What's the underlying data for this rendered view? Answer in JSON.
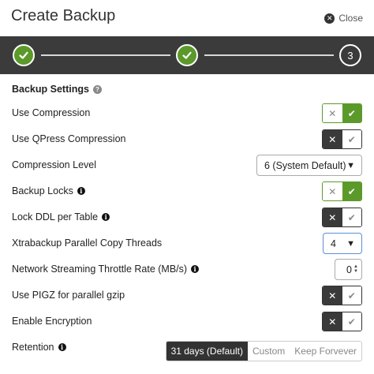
{
  "dialog": {
    "title": "Create Backup",
    "close_label": "Close"
  },
  "stepper": {
    "steps": [
      {
        "state": "done"
      },
      {
        "state": "done"
      },
      {
        "state": "current",
        "label": "3"
      }
    ],
    "colors": {
      "done": "#5b9a2a",
      "bar": "#3b3b3b"
    }
  },
  "settings": {
    "title": "Backup Settings",
    "use_compression": {
      "label": "Use Compression",
      "enabled": true
    },
    "use_qpress": {
      "label": "Use QPress Compression",
      "enabled": false
    },
    "compression_level": {
      "label": "Compression Level",
      "value": "6 (System Default)"
    },
    "backup_locks": {
      "label": "Backup Locks",
      "enabled": true
    },
    "lock_ddl": {
      "label": "Lock DDL per Table",
      "enabled": false
    },
    "parallel_threads": {
      "label": "Xtrabackup Parallel Copy Threads",
      "value": "4"
    },
    "throttle_rate": {
      "label": "Network Streaming Throttle Rate (MB/s)",
      "value": "0"
    },
    "use_pigz": {
      "label": "Use PIGZ for parallel gzip",
      "enabled": false
    },
    "encryption": {
      "label": "Enable Encryption",
      "enabled": false
    },
    "retention": {
      "label": "Retention",
      "options": [
        "31 days (Default)",
        "Custom",
        "Keep Forvever"
      ],
      "selected": "31 days (Default)"
    }
  },
  "icons": {
    "check": "check-icon",
    "cross": "x-icon",
    "info": "info-icon",
    "help": "help-icon",
    "close": "close-icon"
  }
}
